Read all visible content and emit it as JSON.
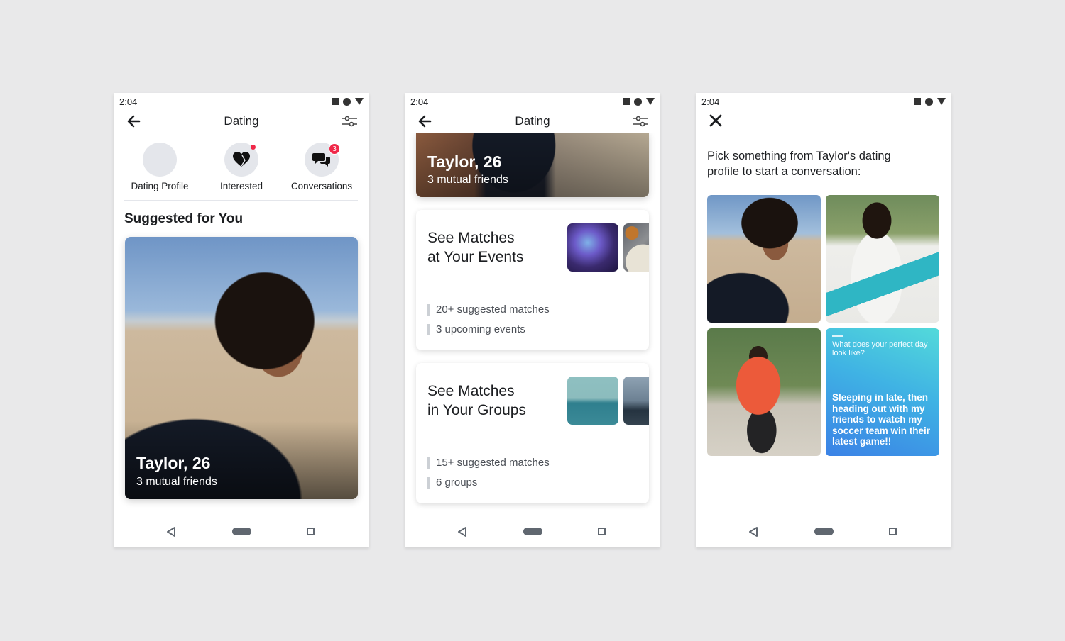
{
  "status_bar": {
    "time": "2:04"
  },
  "screens": [
    {
      "app_bar": {
        "title": "Dating"
      },
      "shortcuts": [
        {
          "label": "Dating Profile",
          "icon": "avatar"
        },
        {
          "label": "Interested",
          "icon": "heart-icon",
          "indicator": "dot"
        },
        {
          "label": "Conversations",
          "icon": "chat-bubbles-icon",
          "badge": "3"
        }
      ],
      "section_title": "Suggested for You",
      "profile_card": {
        "name": "Taylor, 26",
        "subtitle": "3 mutual friends"
      }
    },
    {
      "app_bar": {
        "title": "Dating"
      },
      "profile_card": {
        "name": "Taylor, 26",
        "subtitle": "3 mutual friends"
      },
      "match_cards": [
        {
          "title": "See Matches at Your Events",
          "title_lines": [
            "See Matches",
            "at Your Events"
          ],
          "stats": [
            "20+ suggested matches",
            "3 upcoming events"
          ]
        },
        {
          "title": "See Matches in Your Groups",
          "title_lines": [
            "See Matches",
            "in Your Groups"
          ],
          "stats": [
            "15+ suggested matches",
            "6 groups"
          ]
        }
      ]
    },
    {
      "prompt": "Pick something from Taylor's dating profile to start a conversation:",
      "tiles": [
        {
          "type": "photo",
          "desc": "beach selfie"
        },
        {
          "type": "photo",
          "desc": "yoga mat"
        },
        {
          "type": "photo",
          "desc": "street"
        },
        {
          "type": "question",
          "question": "What does your perfect day look like?",
          "answer": "Sleeping in late, then heading out with my friends to watch my soccer team win their latest game!!"
        }
      ]
    }
  ],
  "colors": {
    "background": "#e9e9ea",
    "badge_red": "#f02849",
    "prompt_gradient_start": "#53dada",
    "prompt_gradient_end": "#3b82e6",
    "nav_gray": "#606770"
  }
}
